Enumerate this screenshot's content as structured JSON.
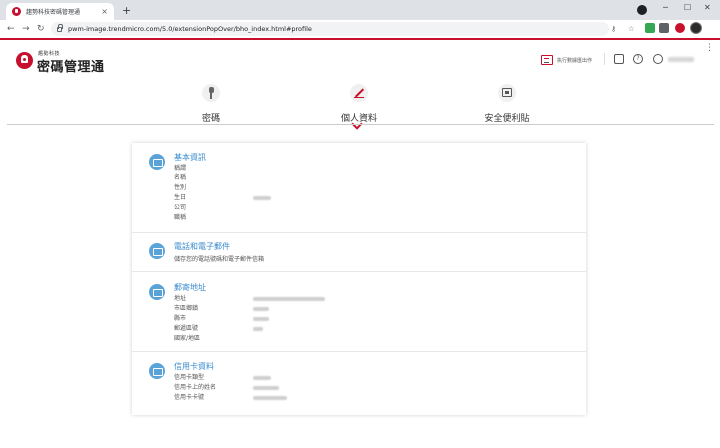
{
  "browser": {
    "tab_title": "趨勢科技密碼管理通",
    "tab_close": "×",
    "new_tab": "+",
    "url": "pwm-image.trendmicro.com/5.0/extensionPopOver/bho_index.html#profile",
    "window_controls": {
      "minimize": "─",
      "maximize": "☐",
      "close": "✕"
    },
    "nav": {
      "back": "←",
      "forward": "→",
      "reload": "↻"
    },
    "omnibox_icons": {
      "key": "⚷",
      "star": "☆"
    },
    "kebab": "⋮"
  },
  "header": {
    "brand_small": "趨勢科技",
    "brand_main": "密碼管理通",
    "action_label": "执行數據匯出作",
    "help_icon_glyph": "?"
  },
  "nav_tabs": [
    {
      "label": "密碼",
      "icon": "key-icon"
    },
    {
      "label": "個人資料",
      "icon": "pen-icon",
      "active": true
    },
    {
      "label": "安全便利貼",
      "icon": "safe-icon"
    }
  ],
  "sections": {
    "basic": {
      "title": "基本資訊",
      "fields": [
        "稱謂",
        "名稱",
        "性別",
        "生日",
        "公司",
        "職稱"
      ]
    },
    "contact": {
      "title": "電話和電子郵件",
      "description": "儲存您的電話號碼和電子郵件信箱"
    },
    "address": {
      "title": "郵寄地址",
      "fields": [
        "地址",
        "市區鄉鎮",
        "縣市",
        "郵遞區號",
        "國家/地區"
      ]
    },
    "card": {
      "title": "信用卡資料",
      "fields": [
        "信用卡類型",
        "信用卡上的姓名",
        "信用卡卡號"
      ]
    }
  },
  "colors": {
    "brand_red": "#c8102e",
    "section_blue": "#3a8ccf",
    "icon_blue": "#5aa3d8"
  }
}
